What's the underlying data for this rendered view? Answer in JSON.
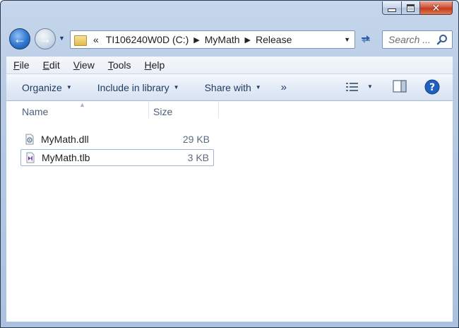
{
  "window": {
    "caption_buttons": {
      "minimize": "minimize",
      "maximize": "maximize",
      "close": "close"
    }
  },
  "navigation": {
    "breadcrumb": {
      "overflow": "«",
      "crumbs": [
        "TI106240W0D (C:)",
        "MyMath",
        "Release"
      ]
    },
    "search": {
      "placeholder": "Search ..."
    }
  },
  "menu": {
    "items": [
      {
        "prefix": "",
        "accel": "F",
        "rest": "ile"
      },
      {
        "prefix": "",
        "accel": "E",
        "rest": "dit"
      },
      {
        "prefix": "",
        "accel": "V",
        "rest": "iew"
      },
      {
        "prefix": "",
        "accel": "T",
        "rest": "ools"
      },
      {
        "prefix": "",
        "accel": "H",
        "rest": "elp"
      }
    ]
  },
  "toolbar": {
    "organize": "Organize",
    "include_in_library": "Include in library",
    "share_with": "Share with",
    "more": "»"
  },
  "columns": {
    "name": "Name",
    "size": "Size"
  },
  "files": [
    {
      "name": "MyMath.dll",
      "size": "29 KB",
      "icon": "dll-file-icon"
    },
    {
      "name": "MyMath.tlb",
      "size": "3 KB",
      "icon": "visual-studio-file-icon"
    }
  ],
  "colors": {
    "accent": "#2f76cf",
    "chrome": "#b7cbe4"
  }
}
